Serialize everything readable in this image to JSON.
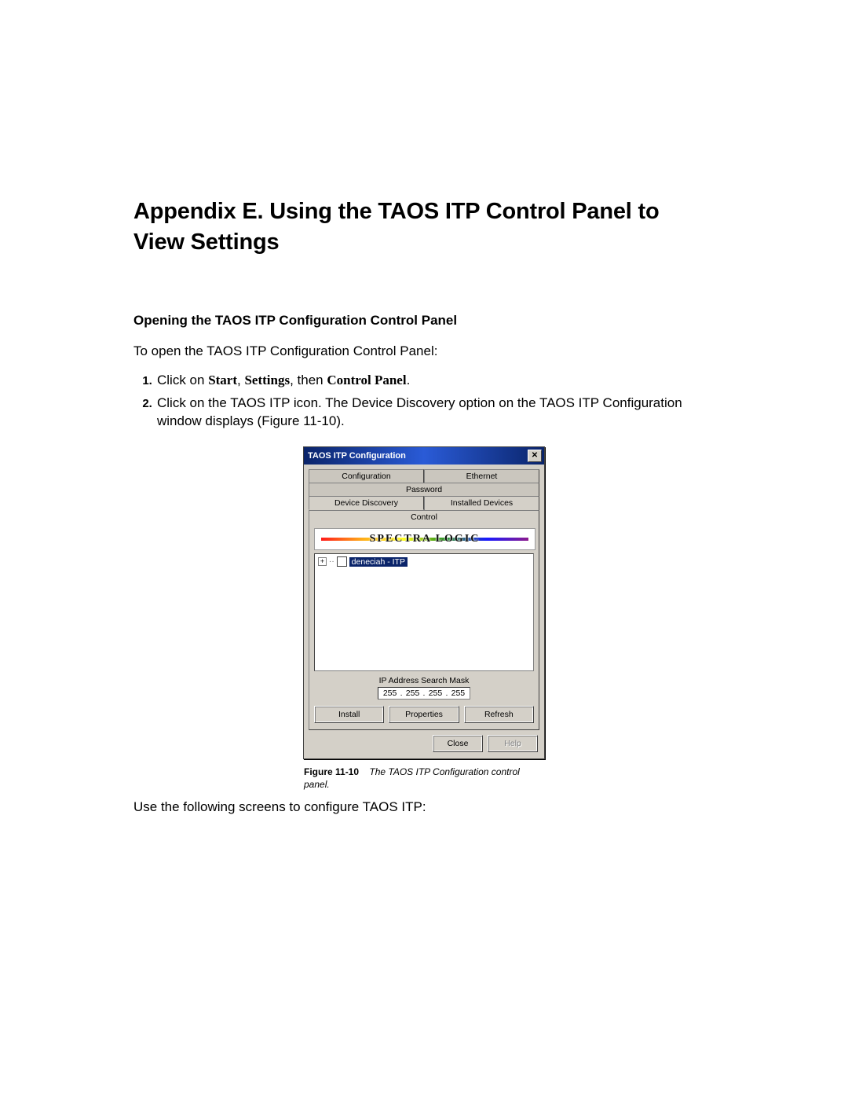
{
  "heading": "Appendix E.  Using the TAOS ITP Control Panel to View Settings",
  "section_heading": "Opening the TAOS ITP Configuration Control Panel",
  "intro": "To open the TAOS ITP Configuration Control Panel:",
  "step1": {
    "prefix": "Click on ",
    "b1": "Start",
    "sep1": ", ",
    "b2": "Settings",
    "mid": ", then ",
    "b3": "Control Panel",
    "suffix": "."
  },
  "step2": "Click on the TAOS ITP icon. The Device Discovery option on the TAOS ITP Configuration window displays (Figure 11-10).",
  "outro": "Use the following screens to configure TAOS ITP:",
  "figure": {
    "label": "Figure 11-10",
    "caption": "The TAOS ITP Configuration control panel."
  },
  "win": {
    "title": "TAOS ITP Configuration",
    "close": "✕",
    "tabs_row1": [
      "Configuration",
      "Ethernet",
      "Password"
    ],
    "tabs_row2": [
      "Device Discovery",
      "Installed Devices",
      "Control"
    ],
    "logo": "SPECTRA LOGIC",
    "tree_expand": "+",
    "tree_node": "deneciah - ITP",
    "ip_label": "IP Address Search Mask",
    "ip": [
      "255",
      "255",
      "255",
      "255"
    ],
    "buttons_row": [
      "Install",
      "Properties",
      "Refresh"
    ],
    "btn_close": "Close",
    "btn_help": "Help"
  }
}
